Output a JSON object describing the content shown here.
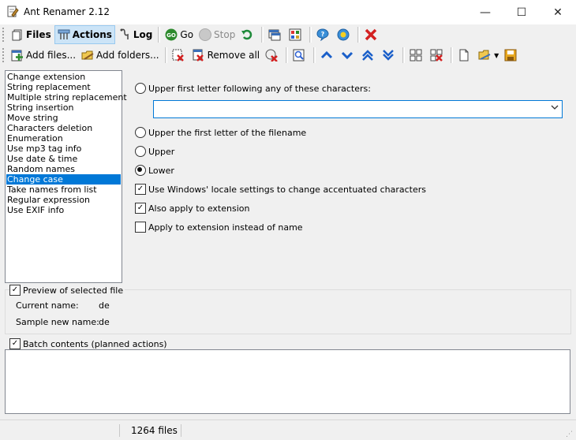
{
  "window": {
    "title": "Ant Renamer 2.12",
    "minimize": "—",
    "maximize": "☐",
    "close": "✕"
  },
  "toolbar1": {
    "files": "Files",
    "actions": "Actions",
    "log": "Log",
    "go": "Go",
    "stop": "Stop"
  },
  "toolbar2": {
    "add_files": "Add files...",
    "add_folders": "Add folders...",
    "remove_all": "Remove all"
  },
  "actions_list": {
    "items": [
      "Change extension",
      "String replacement",
      "Multiple string replacement",
      "String insertion",
      "Move string",
      "Characters deletion",
      "Enumeration",
      "Use mp3 tag info",
      "Use date & time",
      "Random names",
      "Change case",
      "Take names from list",
      "Regular expression",
      "Use EXIF info"
    ],
    "selected": "Change case"
  },
  "options": {
    "upper_first_following": "Upper first letter following any of these characters:",
    "characters_value": "",
    "upper_first_filename": "Upper the first letter of the filename",
    "upper": "Upper",
    "lower": "Lower",
    "selected_case": "Lower",
    "use_locale": "Use Windows' locale settings to change accentuated characters",
    "use_locale_checked": true,
    "apply_ext": "Also apply to extension",
    "apply_ext_checked": true,
    "apply_ext_instead": "Apply to extension instead of name",
    "apply_ext_instead_checked": false
  },
  "preview": {
    "label": "Preview of selected file",
    "checked": true,
    "current_label": "Current name:",
    "current_value": "de",
    "sample_label": "Sample new name:",
    "sample_value": "de"
  },
  "batch": {
    "label": "Batch contents (planned actions)",
    "checked": true
  },
  "status": {
    "file_count": "1264 files"
  },
  "colors": {
    "selection": "#0078d7",
    "accent_blue": "#1a5fc9",
    "red": "#d32020",
    "green": "#2d8a2d"
  }
}
